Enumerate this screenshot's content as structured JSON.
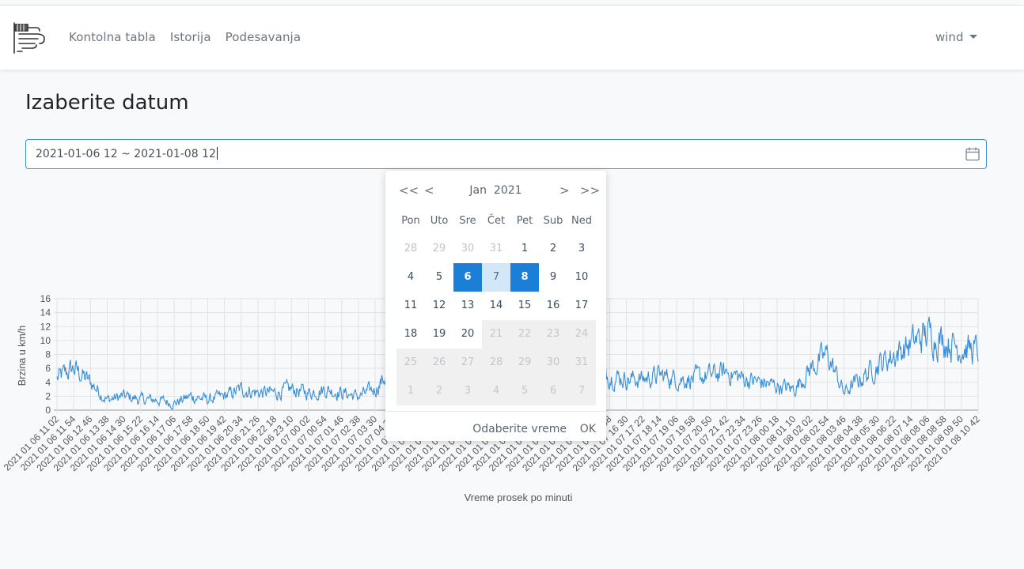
{
  "nav": {
    "links": [
      "Kontolna tabla",
      "Istorija",
      "Podesavanja"
    ],
    "user": "wind"
  },
  "page": {
    "title": "Izaberite datum"
  },
  "date_range": {
    "value": "2021-01-06 12 ~ 2021-01-08 12"
  },
  "picker": {
    "month": "Jan",
    "year": "2021",
    "prev_year": "<<",
    "prev_month": "<",
    "next_month": ">",
    "next_year": ">>",
    "weekdays": [
      "Pon",
      "Uto",
      "Sre",
      "Čet",
      "Pet",
      "Sub",
      "Ned"
    ],
    "weeks": [
      [
        "28",
        "29",
        "30",
        "31",
        "1",
        "2",
        "3"
      ],
      [
        "4",
        "5",
        "6",
        "7",
        "8",
        "9",
        "10"
      ],
      [
        "11",
        "12",
        "13",
        "14",
        "15",
        "16",
        "17"
      ],
      [
        "18",
        "19",
        "20",
        "21",
        "22",
        "23",
        "24"
      ],
      [
        "25",
        "26",
        "27",
        "28",
        "29",
        "30",
        "31"
      ],
      [
        "1",
        "2",
        "3",
        "4",
        "5",
        "6",
        "7"
      ]
    ],
    "range_start": "6",
    "range_end": "8",
    "pick_time": "Odaberite vreme",
    "ok": "OK"
  },
  "chart_data": {
    "type": "line",
    "xlabel": "Vreme prosek po minuti",
    "ylabel": "Brzina u km/h",
    "ylim": [
      0,
      16
    ],
    "yticks": [
      0,
      2,
      4,
      6,
      8,
      10,
      12,
      14,
      16
    ],
    "grid": true,
    "color": "#3a8fd6",
    "x_start": "2021-01-06 11:02",
    "x_end": "2021-01-08 10:42",
    "xtick_labels": [
      "2021 01 06 11 02",
      "2021 01 06 11 54",
      "2021 01 06 12 46",
      "2021 01 06 13 38",
      "2021 01 06 14 30",
      "2021 01 06 15 22",
      "2021 01 06 16 14",
      "2021 01 06 17 06",
      "2021 01 06 17 58",
      "2021 01 06 18 50",
      "2021 01 06 19 42",
      "2021 01 06 20 34",
      "2021 01 06 21 26",
      "2021 01 06 22 18",
      "2021 01 06 23 10",
      "2021 01 07 00 02",
      "2021 01 07 00 54",
      "2021 01 07 01 46",
      "2021 01 07 02 38",
      "2021 01 07 03 30",
      "2021 01 07 04 22",
      "2021 01 07 05 14",
      "2021 01 07 06 06",
      "2021 01 07 06 58",
      "2021 01 07 07 50",
      "2021 01 07 08 42",
      "2021 01 07 09 34",
      "2021 01 07 10 26",
      "2021 01 07 11 18",
      "2021 01 07 12 10",
      "2021 01 07 13 02",
      "2021 01 07 13 54",
      "2021 01 07 14 46",
      "2021 01 07 15 38",
      "2021 01 07 16 30",
      "2021 01 07 17 22",
      "2021 01 07 18 14",
      "2021 01 07 19 06",
      "2021 01 07 19 58",
      "2021 01 07 20 50",
      "2021 01 07 21 42",
      "2021 01 07 22 34",
      "2021 01 07 23 26",
      "2021 01 08 00 18",
      "2021 01 08 01 10",
      "2021 01 08 02 02",
      "2021 01 08 02 54",
      "2021 01 08 03 46",
      "2021 01 08 04 38",
      "2021 01 08 05 30",
      "2021 01 08 06 22",
      "2021 01 08 07 14",
      "2021 01 08 08 06",
      "2021 01 08 08 58",
      "2021 01 08 09 50",
      "2021 01 08 10 42"
    ],
    "series": [
      {
        "values": [
          4.5,
          6.0,
          4.0,
          1.5,
          2.0,
          1.5,
          1.5,
          1.0,
          2.0,
          1.5,
          2.0,
          3.0,
          2.5,
          2.5,
          3.0,
          2.5,
          3.0,
          2.5,
          2.0,
          3.0,
          6.0,
          4.5,
          3.0,
          4.0,
          7.0,
          5.0,
          4.5,
          4.0,
          4.5,
          5.0,
          4.0,
          4.5,
          5.5,
          5.0,
          4.5,
          4.5,
          5.0,
          4.5,
          4.5,
          5.0,
          5.5,
          4.5,
          4.0,
          3.5,
          3.0,
          6.0,
          8.0,
          2.5,
          4.5,
          6.5,
          8.0,
          9.5,
          11.0,
          10.0,
          9.0,
          8.5
        ]
      }
    ]
  }
}
